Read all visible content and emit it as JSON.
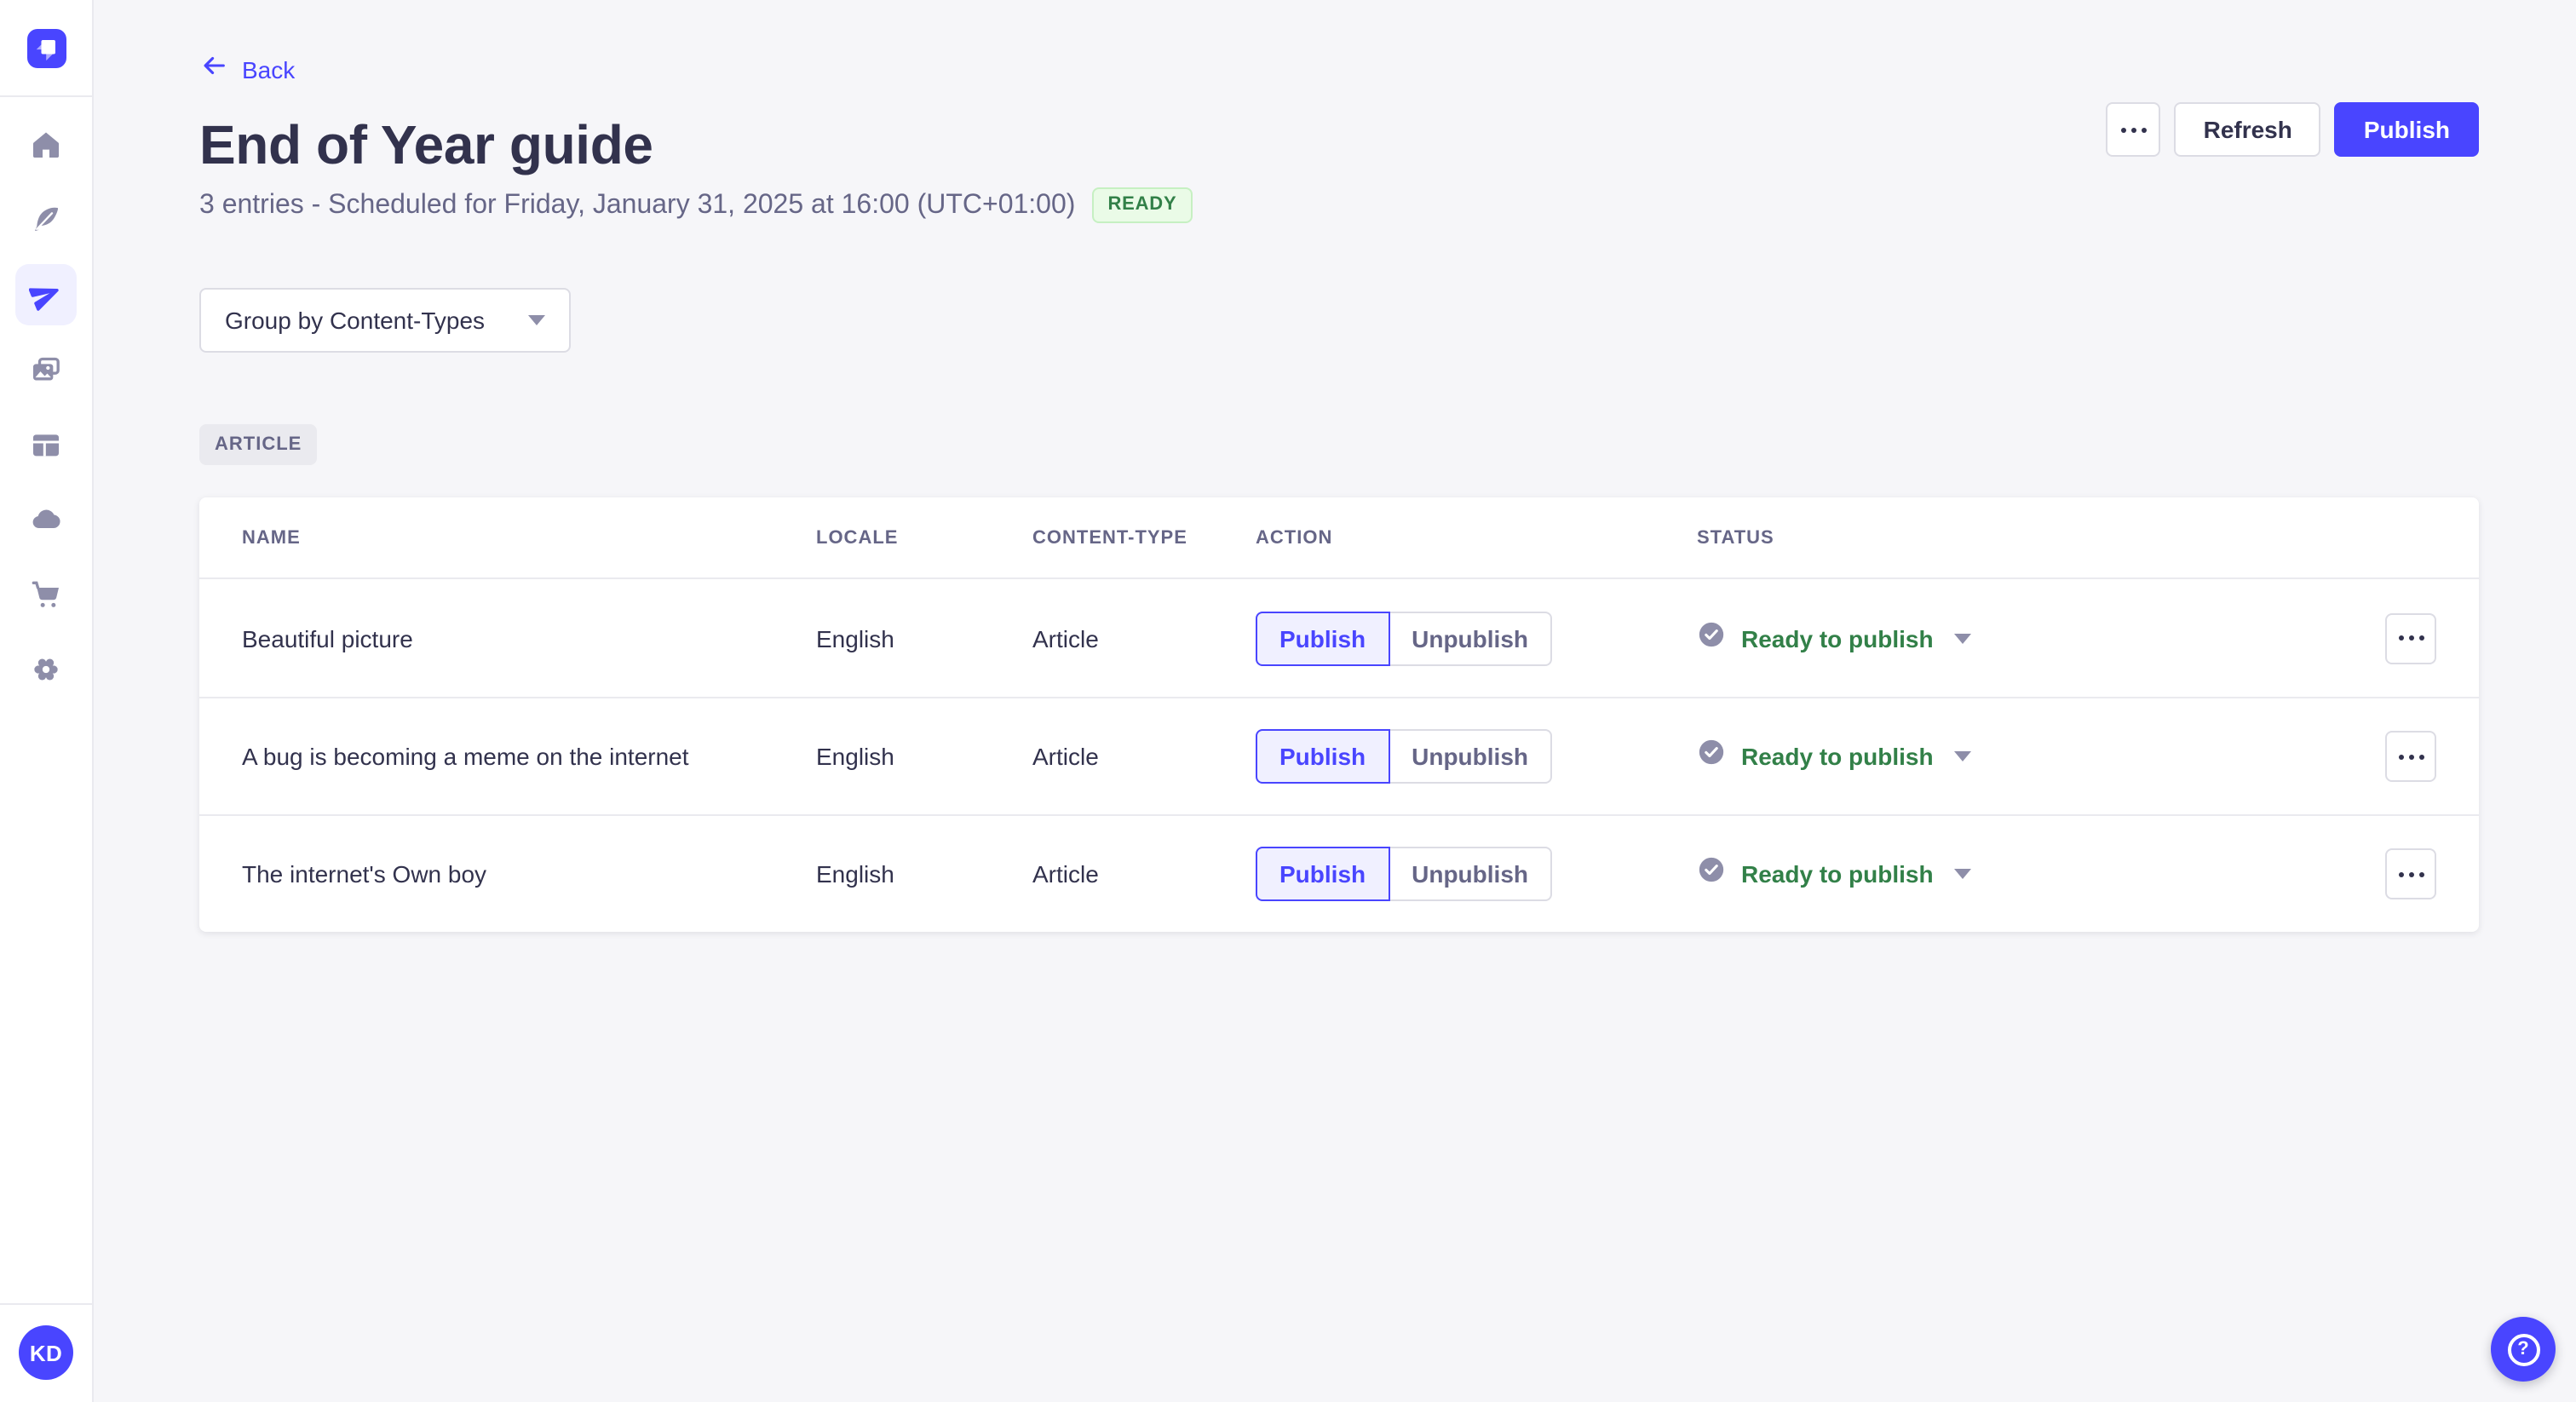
{
  "colors": {
    "accent": "#4945FF",
    "accent_light": "#F0F0FF",
    "page_bg": "#F6F6F9",
    "text_dark": "#32324D",
    "text_gray": "#666687",
    "icon_gray": "#8E8EA9",
    "border": "#DCDCE4",
    "success_text": "#328048",
    "success_bg": "#EAFBE7",
    "success_border": "#C6F0C2"
  },
  "sidebar": {
    "items": [
      {
        "name": "home",
        "icon": "home-icon",
        "active": false
      },
      {
        "name": "content-manager",
        "icon": "feather-icon",
        "active": false
      },
      {
        "name": "releases",
        "icon": "paper-plane-icon",
        "active": true
      },
      {
        "name": "media-library",
        "icon": "pictures-icon",
        "active": false
      },
      {
        "name": "content-type-builder",
        "icon": "layout-icon",
        "active": false
      },
      {
        "name": "cloud",
        "icon": "cloud-icon",
        "active": false
      },
      {
        "name": "marketplace",
        "icon": "cart-icon",
        "active": false
      },
      {
        "name": "settings",
        "icon": "gear-icon",
        "active": false
      }
    ],
    "avatar_initials": "KD"
  },
  "header": {
    "back_label": "Back",
    "title": "End of Year guide",
    "subtitle": "3 entries - Scheduled for Friday, January 31, 2025 at 16:00 (UTC+01:00)",
    "status_badge": "READY",
    "refresh_label": "Refresh",
    "publish_label": "Publish"
  },
  "toolbar": {
    "group_by_label": "Group by Content-Types"
  },
  "group": {
    "label": "ARTICLE"
  },
  "table": {
    "columns": [
      "NAME",
      "LOCALE",
      "CONTENT-TYPE",
      "ACTION",
      "STATUS"
    ],
    "rows": [
      {
        "name": "Beautiful picture",
        "locale": "English",
        "content_type": "Article",
        "publish_label": "Publish",
        "unpublish_label": "Unpublish",
        "status": "Ready to publish"
      },
      {
        "name": "A bug is becoming a meme on the internet",
        "locale": "English",
        "content_type": "Article",
        "publish_label": "Publish",
        "unpublish_label": "Unpublish",
        "status": "Ready to publish"
      },
      {
        "name": "The internet's Own boy",
        "locale": "English",
        "content_type": "Article",
        "publish_label": "Publish",
        "unpublish_label": "Unpublish",
        "status": "Ready to publish"
      }
    ]
  },
  "fab": {
    "help_label": "?"
  }
}
